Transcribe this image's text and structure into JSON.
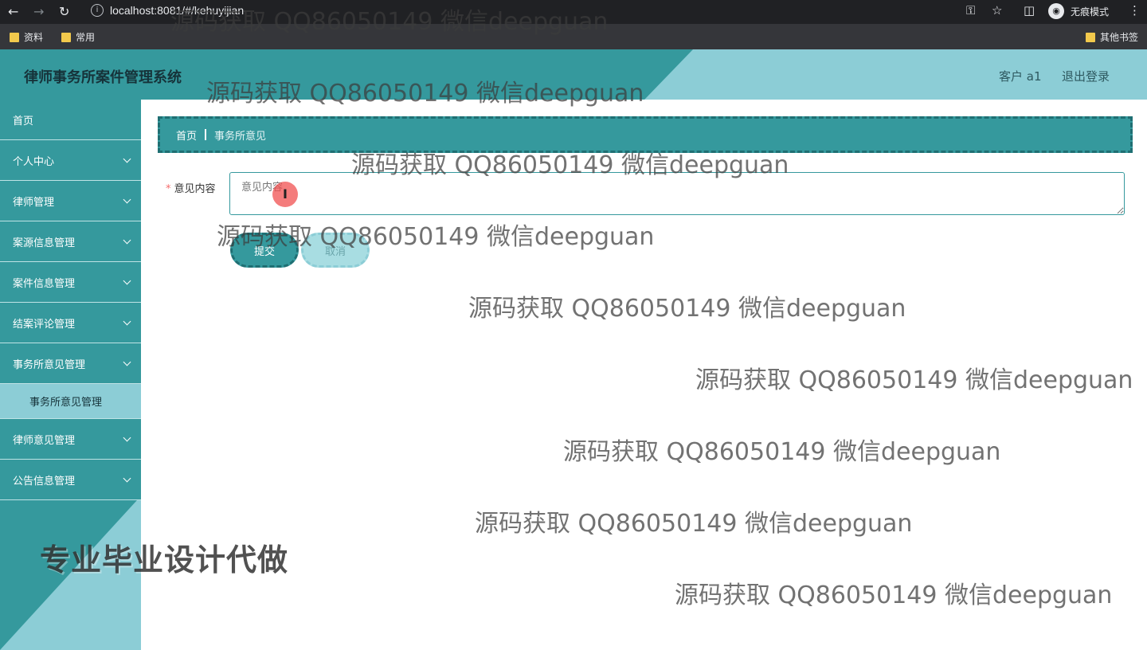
{
  "browser": {
    "url": "localhost:8081/#/kehuyijian",
    "incognito_label": "无痕模式",
    "bookmarks": [
      "资料",
      "常用"
    ],
    "other_bookmarks": "其他书签"
  },
  "header": {
    "title": "律师事务所案件管理系统",
    "user": "客户 a1",
    "logout": "退出登录"
  },
  "sidebar": {
    "items": [
      {
        "label": "首页",
        "expandable": false
      },
      {
        "label": "个人中心",
        "expandable": true
      },
      {
        "label": "律师管理",
        "expandable": true
      },
      {
        "label": "案源信息管理",
        "expandable": true
      },
      {
        "label": "案件信息管理",
        "expandable": true
      },
      {
        "label": "结案评论管理",
        "expandable": true
      },
      {
        "label": "事务所意见管理",
        "expandable": true
      }
    ],
    "submenu_label": "事务所意见管理",
    "items_after": [
      {
        "label": "律师意见管理",
        "expandable": true
      },
      {
        "label": "公告信息管理",
        "expandable": true
      }
    ],
    "promo": "专业毕业设计代做"
  },
  "breadcrumb": {
    "home": "首页",
    "current": "事务所意见"
  },
  "form": {
    "label": "意见内容",
    "required_mark": "*",
    "placeholder": "意见内容",
    "submit": "提交",
    "cancel": "取消"
  },
  "watermark_text": "源码获取 QQ86050149 微信deepguan",
  "colors": {
    "primary": "#35999d",
    "light": "#8ccdd6"
  }
}
